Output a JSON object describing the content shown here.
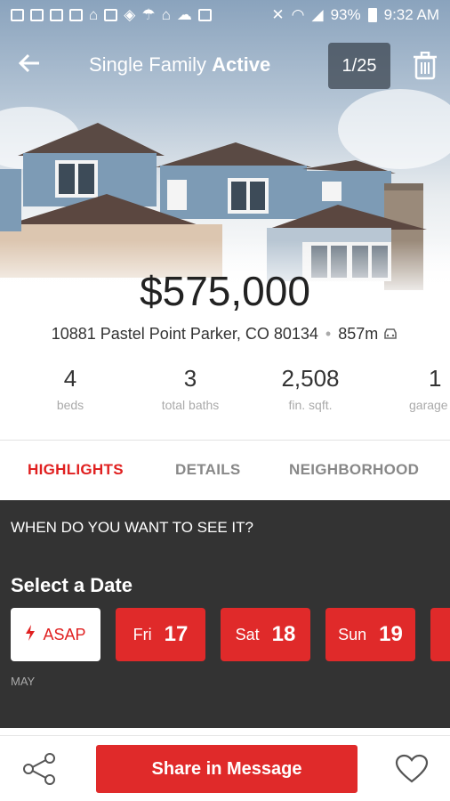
{
  "status_bar": {
    "battery": "93%",
    "time": "9:32 AM"
  },
  "header": {
    "title_prefix": "Single Family",
    "title_status": "Active",
    "photo_counter": "1/25"
  },
  "listing": {
    "price": "$575,000",
    "address": "10881 Pastel Point Parker, CO 80134",
    "distance": "857m"
  },
  "stats": [
    {
      "value": "4",
      "label": "beds"
    },
    {
      "value": "3",
      "label": "total baths"
    },
    {
      "value": "2,508",
      "label": "fin. sqft."
    },
    {
      "value": "1",
      "label": "garage"
    }
  ],
  "tabs": [
    {
      "label": "HIGHLIGHTS",
      "active": true
    },
    {
      "label": "DETAILS",
      "active": false
    },
    {
      "label": "NEIGHBORHOOD",
      "active": false
    }
  ],
  "schedule": {
    "question": "WHEN DO YOU WANT TO SEE IT?",
    "select_label": "Select a Date",
    "asap_label": "ASAP",
    "month": "MAY",
    "dates": [
      {
        "day": "Fri",
        "date": "17"
      },
      {
        "day": "Sat",
        "date": "18"
      },
      {
        "day": "Sun",
        "date": "19"
      }
    ]
  },
  "bottom_bar": {
    "share_label": "Share in Message"
  },
  "colors": {
    "accent": "#e02a2a",
    "dark_bg": "#333333"
  }
}
